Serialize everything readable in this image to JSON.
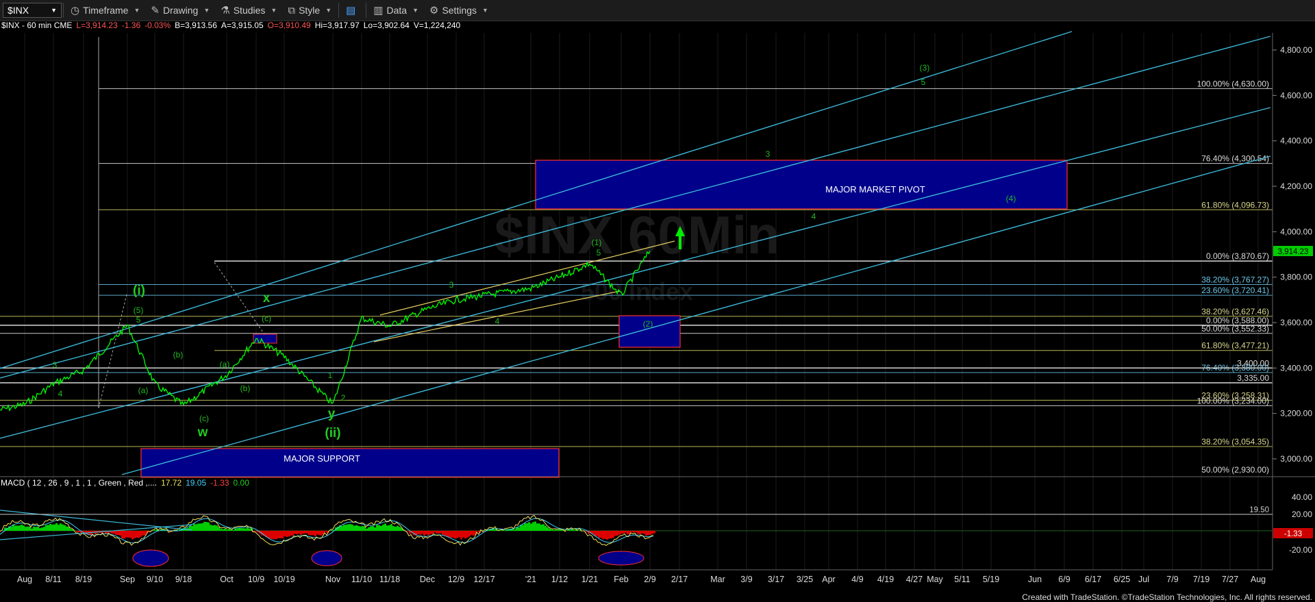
{
  "toolbar": {
    "symbol": "$INX",
    "items": [
      {
        "id": "timeframe",
        "label": "Timeframe",
        "icon": "clock-icon"
      },
      {
        "id": "drawing",
        "label": "Drawing",
        "icon": "pencil-icon"
      },
      {
        "id": "studies",
        "label": "Studies",
        "icon": "flask-icon"
      },
      {
        "id": "style",
        "label": "Style",
        "icon": "style-icon"
      },
      {
        "id": "data",
        "label": "Data",
        "icon": "bar-chart-icon"
      },
      {
        "id": "settings",
        "label": "Settings",
        "icon": "gear-icon"
      }
    ]
  },
  "info": {
    "symbol_line": "$INX - 60 min  CME",
    "last": "L=3,914.23",
    "change": "-1.36",
    "change_pct": "-0.03%",
    "bid": "B=3,913.56",
    "ask": "A=3,915.05",
    "open": "O=3,910.49",
    "high": "Hi=3,917.97",
    "low": "Lo=3,902.64",
    "volume": "V=1,224,240"
  },
  "watermark": {
    "symbol": "$INX 60Min",
    "name": "500 Index"
  },
  "last_price_tag": "3,914.23",
  "colors": {
    "price": "#00ff00",
    "channel": "#3cb8d8",
    "fib": "#cccccc",
    "box_fill": "#00008b",
    "box_border": "#ff3030",
    "label_green": "#22cc22"
  },
  "chart_data": {
    "type": "line",
    "title": "$INX - 60 min",
    "price_axis": {
      "ticks": [
        "4,800.00",
        "4,600.00",
        "4,400.00",
        "4,200.00",
        "4,000.00",
        "3,800.00",
        "3,600.00",
        "3,400.00",
        "3,200.00",
        "3,000.00"
      ],
      "ylim": [
        2930,
        4880
      ]
    },
    "x_ticks": [
      "Aug",
      "8/11",
      "8/19",
      "Sep",
      "9/10",
      "9/18",
      "Oct",
      "10/9",
      "10/19",
      "Nov",
      "11/10",
      "11/18",
      "Dec",
      "12/9",
      "12/17",
      "'21",
      "1/12",
      "1/21",
      "Feb",
      "2/9",
      "2/17",
      "Mar",
      "3/9",
      "3/17",
      "3/25",
      "Apr",
      "4/9",
      "4/19",
      "4/27",
      "May",
      "5/11",
      "5/19",
      "Jun",
      "6/9",
      "6/17",
      "6/25",
      "Jul",
      "7/9",
      "7/19",
      "7/27",
      "Aug"
    ],
    "series_price": [
      [
        "Aug",
        3240
      ],
      [
        "8/11",
        3330
      ],
      [
        "8/19",
        3390
      ],
      [
        "Sep",
        3588
      ],
      [
        "9/10",
        3330
      ],
      [
        "9/18",
        3235
      ],
      [
        "Oct",
        3370
      ],
      [
        "10/9",
        3530
      ],
      [
        "10/19",
        3450
      ],
      [
        "Nov",
        3240
      ],
      [
        "11/10",
        3620
      ],
      [
        "11/18",
        3585
      ],
      [
        "Dec",
        3660
      ],
      [
        "12/9",
        3700
      ],
      [
        "12/17",
        3720
      ],
      [
        "'21",
        3750
      ],
      [
        "1/12",
        3800
      ],
      [
        "1/21",
        3860
      ],
      [
        "Feb",
        3720
      ],
      [
        "2/9",
        3915
      ]
    ],
    "fib_levels": [
      {
        "label": "100.00% (4,630.00)",
        "value": 4630
      },
      {
        "label": "76.40% (4,300.54)",
        "value": 4300.54
      },
      {
        "label": "61.80% (4,096.73)",
        "value": 4096.73
      },
      {
        "label": "0.00% (3,870.67)",
        "value": 3870.67
      },
      {
        "label": "38.20% (3,767.27)",
        "value": 3767.27
      },
      {
        "label": "23.60% (3,720.41)",
        "value": 3720.41
      },
      {
        "label": "38.20% (3,627.46)",
        "value": 3627.46
      },
      {
        "label": "0.00% (3,588.00)",
        "value": 3588
      },
      {
        "label": "50.00% (3,552.33)",
        "value": 3552.33
      },
      {
        "label": "61.80% (3,477.21)",
        "value": 3477.21
      },
      {
        "label": "76.40% (3,380.00)",
        "value": 3380
      },
      {
        "label": "3,400.00",
        "value": 3400
      },
      {
        "label": "3,335.00",
        "value": 3335
      },
      {
        "label": "23.60% (3,258.31)",
        "value": 3258.31
      },
      {
        "label": "100.00% (3,234.00)",
        "value": 3234
      },
      {
        "label": "38.20% (3,054.35)",
        "value": 3054.35
      },
      {
        "label": "50.00% (2,930.00)",
        "value": 2930
      }
    ],
    "zones": [
      {
        "label": "MAJOR MARKET PIVOT",
        "from": 4096.73,
        "to": 4315
      },
      {
        "label": "MAJOR SUPPORT",
        "from": 2930,
        "to": 3045
      },
      {
        "label": "",
        "from": 3477,
        "to": 3620
      }
    ],
    "wave_labels": [
      {
        "text": "(i)",
        "large": true
      },
      {
        "text": "(5)"
      },
      {
        "text": "5"
      },
      {
        "text": "3"
      },
      {
        "text": "4"
      },
      {
        "text": "(a)"
      },
      {
        "text": "(b)"
      },
      {
        "text": "(c)"
      },
      {
        "text": "w",
        "large": true
      },
      {
        "text": "(a)"
      },
      {
        "text": "(b)"
      },
      {
        "text": "(c)"
      },
      {
        "text": "x",
        "large": true
      },
      {
        "text": "1"
      },
      {
        "text": "2"
      },
      {
        "text": "y",
        "large": true
      },
      {
        "text": "(ii)",
        "large": true
      },
      {
        "text": "3"
      },
      {
        "text": "4"
      },
      {
        "text": "(1)"
      },
      {
        "text": "5"
      },
      {
        "text": "(2)"
      },
      {
        "text": "3"
      },
      {
        "text": "4"
      },
      {
        "text": "(3)"
      },
      {
        "text": "5"
      },
      {
        "text": "(4)"
      }
    ],
    "macd": {
      "title": "MACD ( 12 , 26 , 9 , 1 , 1 , Green , Red ,....",
      "macd": "17.72",
      "signal": "19.05",
      "hist": "-1.33",
      "zero": "0.00",
      "axis_ticks": [
        "40.00",
        "20.00",
        "-20.00"
      ],
      "marker_line": "19.50",
      "hist_tag": "-1.33"
    }
  },
  "footer": "Created with TradeStation. ©TradeStation Technologies, Inc. All rights reserved."
}
